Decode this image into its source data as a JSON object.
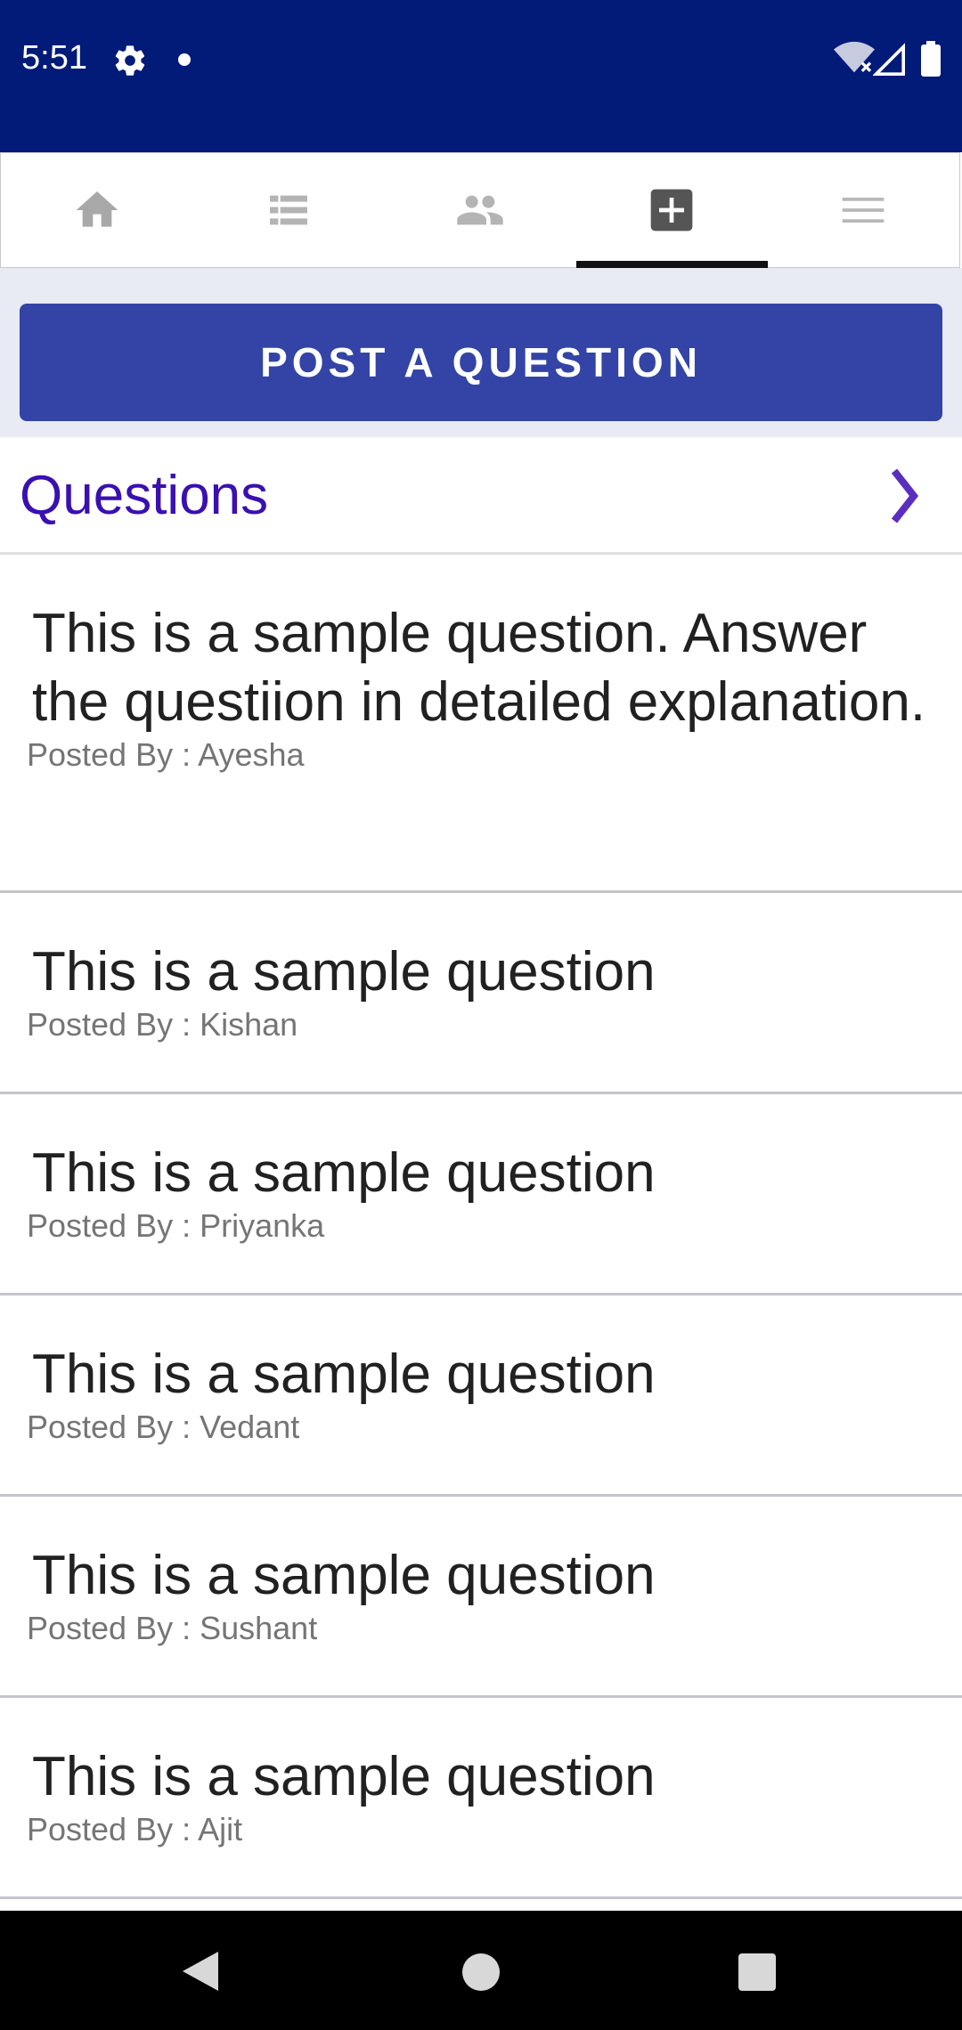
{
  "status_bar": {
    "time": "5:51",
    "icons": [
      "gear-icon",
      "dot-icon",
      "wifi-icon",
      "signal-icon",
      "battery-icon"
    ],
    "background": "#021a78"
  },
  "tabs": [
    {
      "name": "home",
      "icon": "home-icon",
      "active": false
    },
    {
      "name": "list",
      "icon": "list-icon",
      "active": false
    },
    {
      "name": "people",
      "icon": "people-icon",
      "active": false
    },
    {
      "name": "add",
      "icon": "add-box-icon",
      "active": true
    },
    {
      "name": "menu",
      "icon": "menu-icon",
      "active": false
    }
  ],
  "post_button": {
    "label": "POST A QUESTION",
    "color": "#3344a6"
  },
  "questions_header": {
    "title": "Questions",
    "accent": "#3a10b0"
  },
  "questions": [
    {
      "text": "This is a sample question. Answer the questiion in detailed explanation.",
      "posted_by": "Posted By : Ayesha"
    },
    {
      "text": "This is a sample question",
      "posted_by": "Posted By : Kishan"
    },
    {
      "text": "This is a sample question",
      "posted_by": "Posted By : Priyanka"
    },
    {
      "text": "This is a sample question",
      "posted_by": "Posted By : Vedant"
    },
    {
      "text": "This is a sample question",
      "posted_by": "Posted By : Sushant"
    },
    {
      "text": "This is a sample question",
      "posted_by": "Posted By : Ajit"
    }
  ],
  "nav_bar": {
    "icons": [
      "back-icon",
      "home-circle-icon",
      "recents-icon"
    ]
  }
}
